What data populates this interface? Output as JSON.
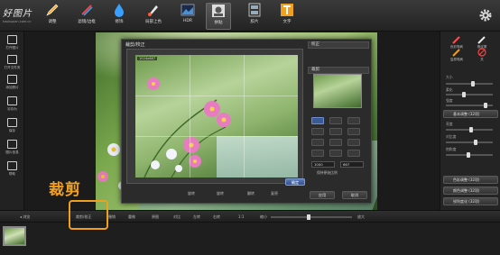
{
  "app": {
    "brand": "好图片",
    "url_text": "haotupian.com.cn",
    "accent_color": "#f0a020"
  },
  "toolbar": {
    "tools": [
      {
        "label": "调整",
        "icon": "pencil-icon"
      },
      {
        "label": "滤镜/边框",
        "icon": "palette-icon"
      },
      {
        "label": "修饰",
        "icon": "droplet-icon"
      },
      {
        "label": "局部上色",
        "icon": "brush-icon"
      },
      {
        "label": "HDR",
        "icon": "hdr-icon"
      },
      {
        "label": "拼贴",
        "icon": "collage-icon"
      },
      {
        "label": "胶片",
        "icon": "film-icon"
      },
      {
        "label": "文字",
        "icon": "text-icon"
      }
    ],
    "settings_icon": "gear-icon"
  },
  "leftbar": {
    "items": [
      {
        "label": "打开图片",
        "icon": "folder-icon"
      },
      {
        "label": "打开文件夹",
        "icon": "folder-open-icon"
      },
      {
        "label": "添加照片",
        "icon": "add-photo-icon"
      },
      {
        "label": "另存为",
        "icon": "save-as-icon"
      },
      {
        "label": "保存",
        "icon": "save-icon"
      },
      {
        "label": "图片信息",
        "icon": "info-icon"
      },
      {
        "label": "帮助",
        "icon": "help-icon"
      }
    ]
  },
  "dialog": {
    "title": "裁剪/校正",
    "close_glyph": "×",
    "size_tag": "1024x687",
    "ok_label": "确定",
    "bottom": {
      "rotate_left": "旋转",
      "rotate_right": "旋转",
      "flip": "翻转",
      "reset": "复原"
    },
    "right": {
      "section1": "校正",
      "section2": "裁剪",
      "width_value": "1000",
      "height_value": "667",
      "keep_ratio": "保持原始比例",
      "apply_label": "应用",
      "cancel_label": "取消"
    }
  },
  "rightbar": {
    "tools": [
      {
        "label": "色彩笔刷",
        "icon": "color-brush-icon"
      },
      {
        "label": "橡皮擦",
        "icon": "eraser-icon"
      },
      {
        "label": "复原笔刷",
        "icon": "restore-brush-icon"
      },
      {
        "label": "关",
        "icon": "off-icon"
      }
    ],
    "sliders": [
      {
        "label": "大小",
        "value": 0.55
      },
      {
        "label": "柔化",
        "value": 0.35
      },
      {
        "label": "强度",
        "value": 0.8
      }
    ],
    "sections": [
      {
        "label": "基本调整 (32项)"
      },
      {
        "label": "色彩调整 (32项)"
      },
      {
        "label": "颜色调整 (32项)"
      },
      {
        "label": "锐利度化 (32项)"
      }
    ],
    "adjust_sliders": [
      {
        "label": "亮度",
        "value": 0.5
      },
      {
        "label": "对比度",
        "value": 0.6
      },
      {
        "label": "饱和度",
        "value": 0.45
      }
    ]
  },
  "bottombar": {
    "items": [
      {
        "label": "◂ 浏览"
      },
      {
        "label": "裁剪/校正"
      },
      {
        "label": "撤销"
      },
      {
        "label": "重做"
      },
      {
        "label": "原图"
      },
      {
        "label": "对比"
      },
      {
        "label": "左转"
      },
      {
        "label": "右转"
      },
      {
        "label": "1:1"
      },
      {
        "label": "缩小"
      },
      {
        "label": "放大"
      }
    ]
  },
  "annotation": {
    "label": "裁剪"
  }
}
